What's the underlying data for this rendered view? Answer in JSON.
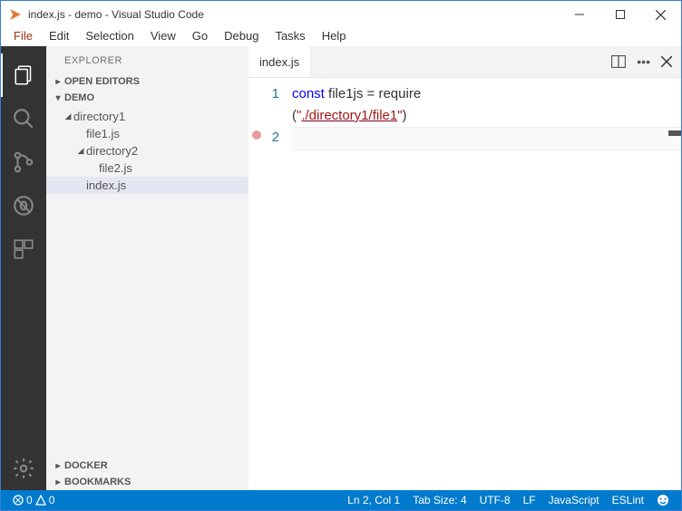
{
  "window": {
    "title": "index.js - demo - Visual Studio Code"
  },
  "menu": {
    "items": [
      "File",
      "Edit",
      "Selection",
      "View",
      "Go",
      "Debug",
      "Tasks",
      "Help"
    ]
  },
  "activitybar": {
    "icons": [
      "files",
      "search",
      "source-control",
      "debug",
      "extensions",
      "gear"
    ]
  },
  "sidebar": {
    "title": "EXPLORER",
    "sections": {
      "openEditors": "OPEN EDITORS",
      "demo": "DEMO",
      "docker": "DOCKER",
      "bookmarks": "BOOKMARKS"
    },
    "tree": {
      "dir1": "directory1",
      "file1": "file1.js",
      "dir2": "directory2",
      "file2": "file2.js",
      "index": "index.js"
    }
  },
  "editor": {
    "tab": "index.js",
    "lineNumbers": [
      "1",
      "2"
    ],
    "code": {
      "kw": "const",
      "ident": " file1js = require",
      "paren1": "(",
      "q1": "\"",
      "path": "./directory1/file1",
      "q2": "\"",
      "paren2": ")"
    }
  },
  "status": {
    "errors": "0",
    "warnings": "0",
    "lncol": "Ln 2, Col 1",
    "tabsize": "Tab Size: 4",
    "encoding": "UTF-8",
    "eol": "LF",
    "language": "JavaScript",
    "linter": "ESLint"
  }
}
